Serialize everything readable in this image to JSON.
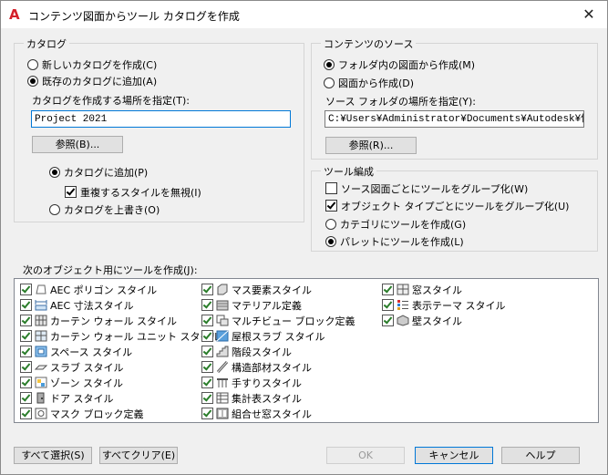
{
  "window": {
    "title": "コンテンツ図面からツール カタログを作成",
    "close_glyph": "✕"
  },
  "catalog": {
    "group_label": "カタログ",
    "new_catalog": "新しいカタログを作成(C)",
    "existing_catalog": "既存のカタログに追加(A)",
    "location_label": "カタログを作成する場所を指定(T):",
    "location_value": "Project 2021",
    "browse": "参照(B)...",
    "add_to_catalog": "カタログに追加(P)",
    "ignore_duplicates": "重複するスタイルを無視(I)",
    "overwrite_catalog": "カタログを上書き(O)"
  },
  "source": {
    "group_label": "コンテンツのソース",
    "from_folder": "フォルダ内の図面から作成(M)",
    "from_drawing": "図面から作成(D)",
    "folder_label": "ソース フォルダの場所を指定(Y):",
    "folder_value": "C:¥Users¥Administrator¥Documents¥Autodesk¥個人用",
    "browse": "参照(R)..."
  },
  "tools": {
    "group_label": "ツール編成",
    "group_by_drawing": "ソース図面ごとにツールをグループ化(W)",
    "group_by_type": "オブジェクト タイプごとにツールをグループ化(U)",
    "create_in_category": "カテゴリにツールを作成(G)",
    "create_in_palette": "パレットにツールを作成(L)"
  },
  "objects": {
    "label": "次のオブジェクト用にツールを作成(J):",
    "columns": [
      [
        {
          "label": "AEC ポリゴン スタイル",
          "icon": "polygon-icon"
        },
        {
          "label": "AEC 寸法スタイル",
          "icon": "dimension-icon"
        },
        {
          "label": "カーテン ウォール スタイル",
          "icon": "curtain-wall-icon"
        },
        {
          "label": "カーテン ウォール ユニット スタイル",
          "icon": "curtain-wall-unit-icon"
        },
        {
          "label": "スペース スタイル",
          "icon": "space-icon"
        },
        {
          "label": "スラブ スタイル",
          "icon": "slab-icon"
        },
        {
          "label": "ゾーン スタイル",
          "icon": "zone-icon"
        },
        {
          "label": "ドア スタイル",
          "icon": "door-icon"
        },
        {
          "label": "マスク ブロック定義",
          "icon": "mask-block-icon"
        }
      ],
      [
        {
          "label": "マス要素スタイル",
          "icon": "mass-element-icon"
        },
        {
          "label": "マテリアル定義",
          "icon": "material-icon"
        },
        {
          "label": "マルチビュー ブロック定義",
          "icon": "multiview-block-icon"
        },
        {
          "label": "屋根スラブ スタイル",
          "icon": "roof-slab-icon"
        },
        {
          "label": "階段スタイル",
          "icon": "stair-icon"
        },
        {
          "label": "構造部材スタイル",
          "icon": "structural-member-icon"
        },
        {
          "label": "手すりスタイル",
          "icon": "railing-icon"
        },
        {
          "label": "集計表スタイル",
          "icon": "schedule-table-icon"
        },
        {
          "label": "組合せ窓スタイル",
          "icon": "window-assembly-icon"
        }
      ],
      [
        {
          "label": "窓スタイル",
          "icon": "window-icon"
        },
        {
          "label": "表示テーマ スタイル",
          "icon": "display-theme-icon"
        },
        {
          "label": "壁スタイル",
          "icon": "wall-icon"
        }
      ]
    ]
  },
  "buttons": {
    "select_all": "すべて選択(S)",
    "clear_all": "すべてクリア(E)",
    "ok": "OK",
    "cancel": "キャンセル",
    "help": "ヘルプ"
  }
}
